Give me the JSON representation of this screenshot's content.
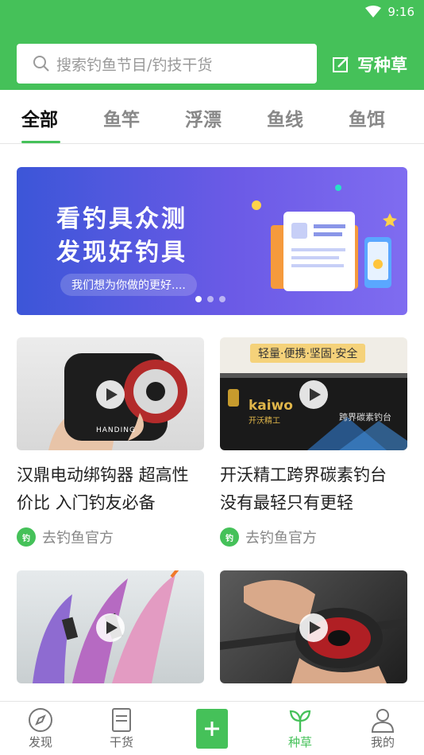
{
  "status": {
    "time": "9:16"
  },
  "search": {
    "placeholder": "搜索钓鱼节目/钓技干货"
  },
  "header": {
    "write_label": "写种草"
  },
  "tabs": [
    {
      "label": "全部",
      "active": true
    },
    {
      "label": "鱼竿"
    },
    {
      "label": "浮漂"
    },
    {
      "label": "鱼线"
    },
    {
      "label": "鱼饵"
    }
  ],
  "banner": {
    "line1": "看钓具众测",
    "line2": "发现好钓具",
    "pill": "我们想为你做的更好....",
    "slides": 3,
    "active_slide": 1
  },
  "cards": [
    {
      "title": "汉鼎电动绑钩器 超高性价比 入门钓友必备",
      "author": "去钓鱼官方",
      "thumb_brand": "HANDING"
    },
    {
      "title": "开沃精工跨界碳素钓台 没有最轻只有更轻",
      "author": "去钓鱼官方",
      "thumb_tag": "轻量·便携·坚固·安全",
      "thumb_brand": "kaiwo",
      "thumb_sub": "开沃精工",
      "thumb_mark": "跨界碳素钓台"
    },
    {
      "title": "",
      "author": ""
    },
    {
      "title": "",
      "author": ""
    }
  ],
  "bottom_nav": [
    {
      "label": "发现",
      "icon": "compass-icon"
    },
    {
      "label": "干货",
      "icon": "document-icon"
    },
    {
      "label": "",
      "icon": "plus-icon"
    },
    {
      "label": "种草",
      "icon": "sprout-icon",
      "active": true
    },
    {
      "label": "我的",
      "icon": "user-icon"
    }
  ],
  "colors": {
    "brand_green": "#45c159",
    "banner_blue": "#3c56d8"
  }
}
